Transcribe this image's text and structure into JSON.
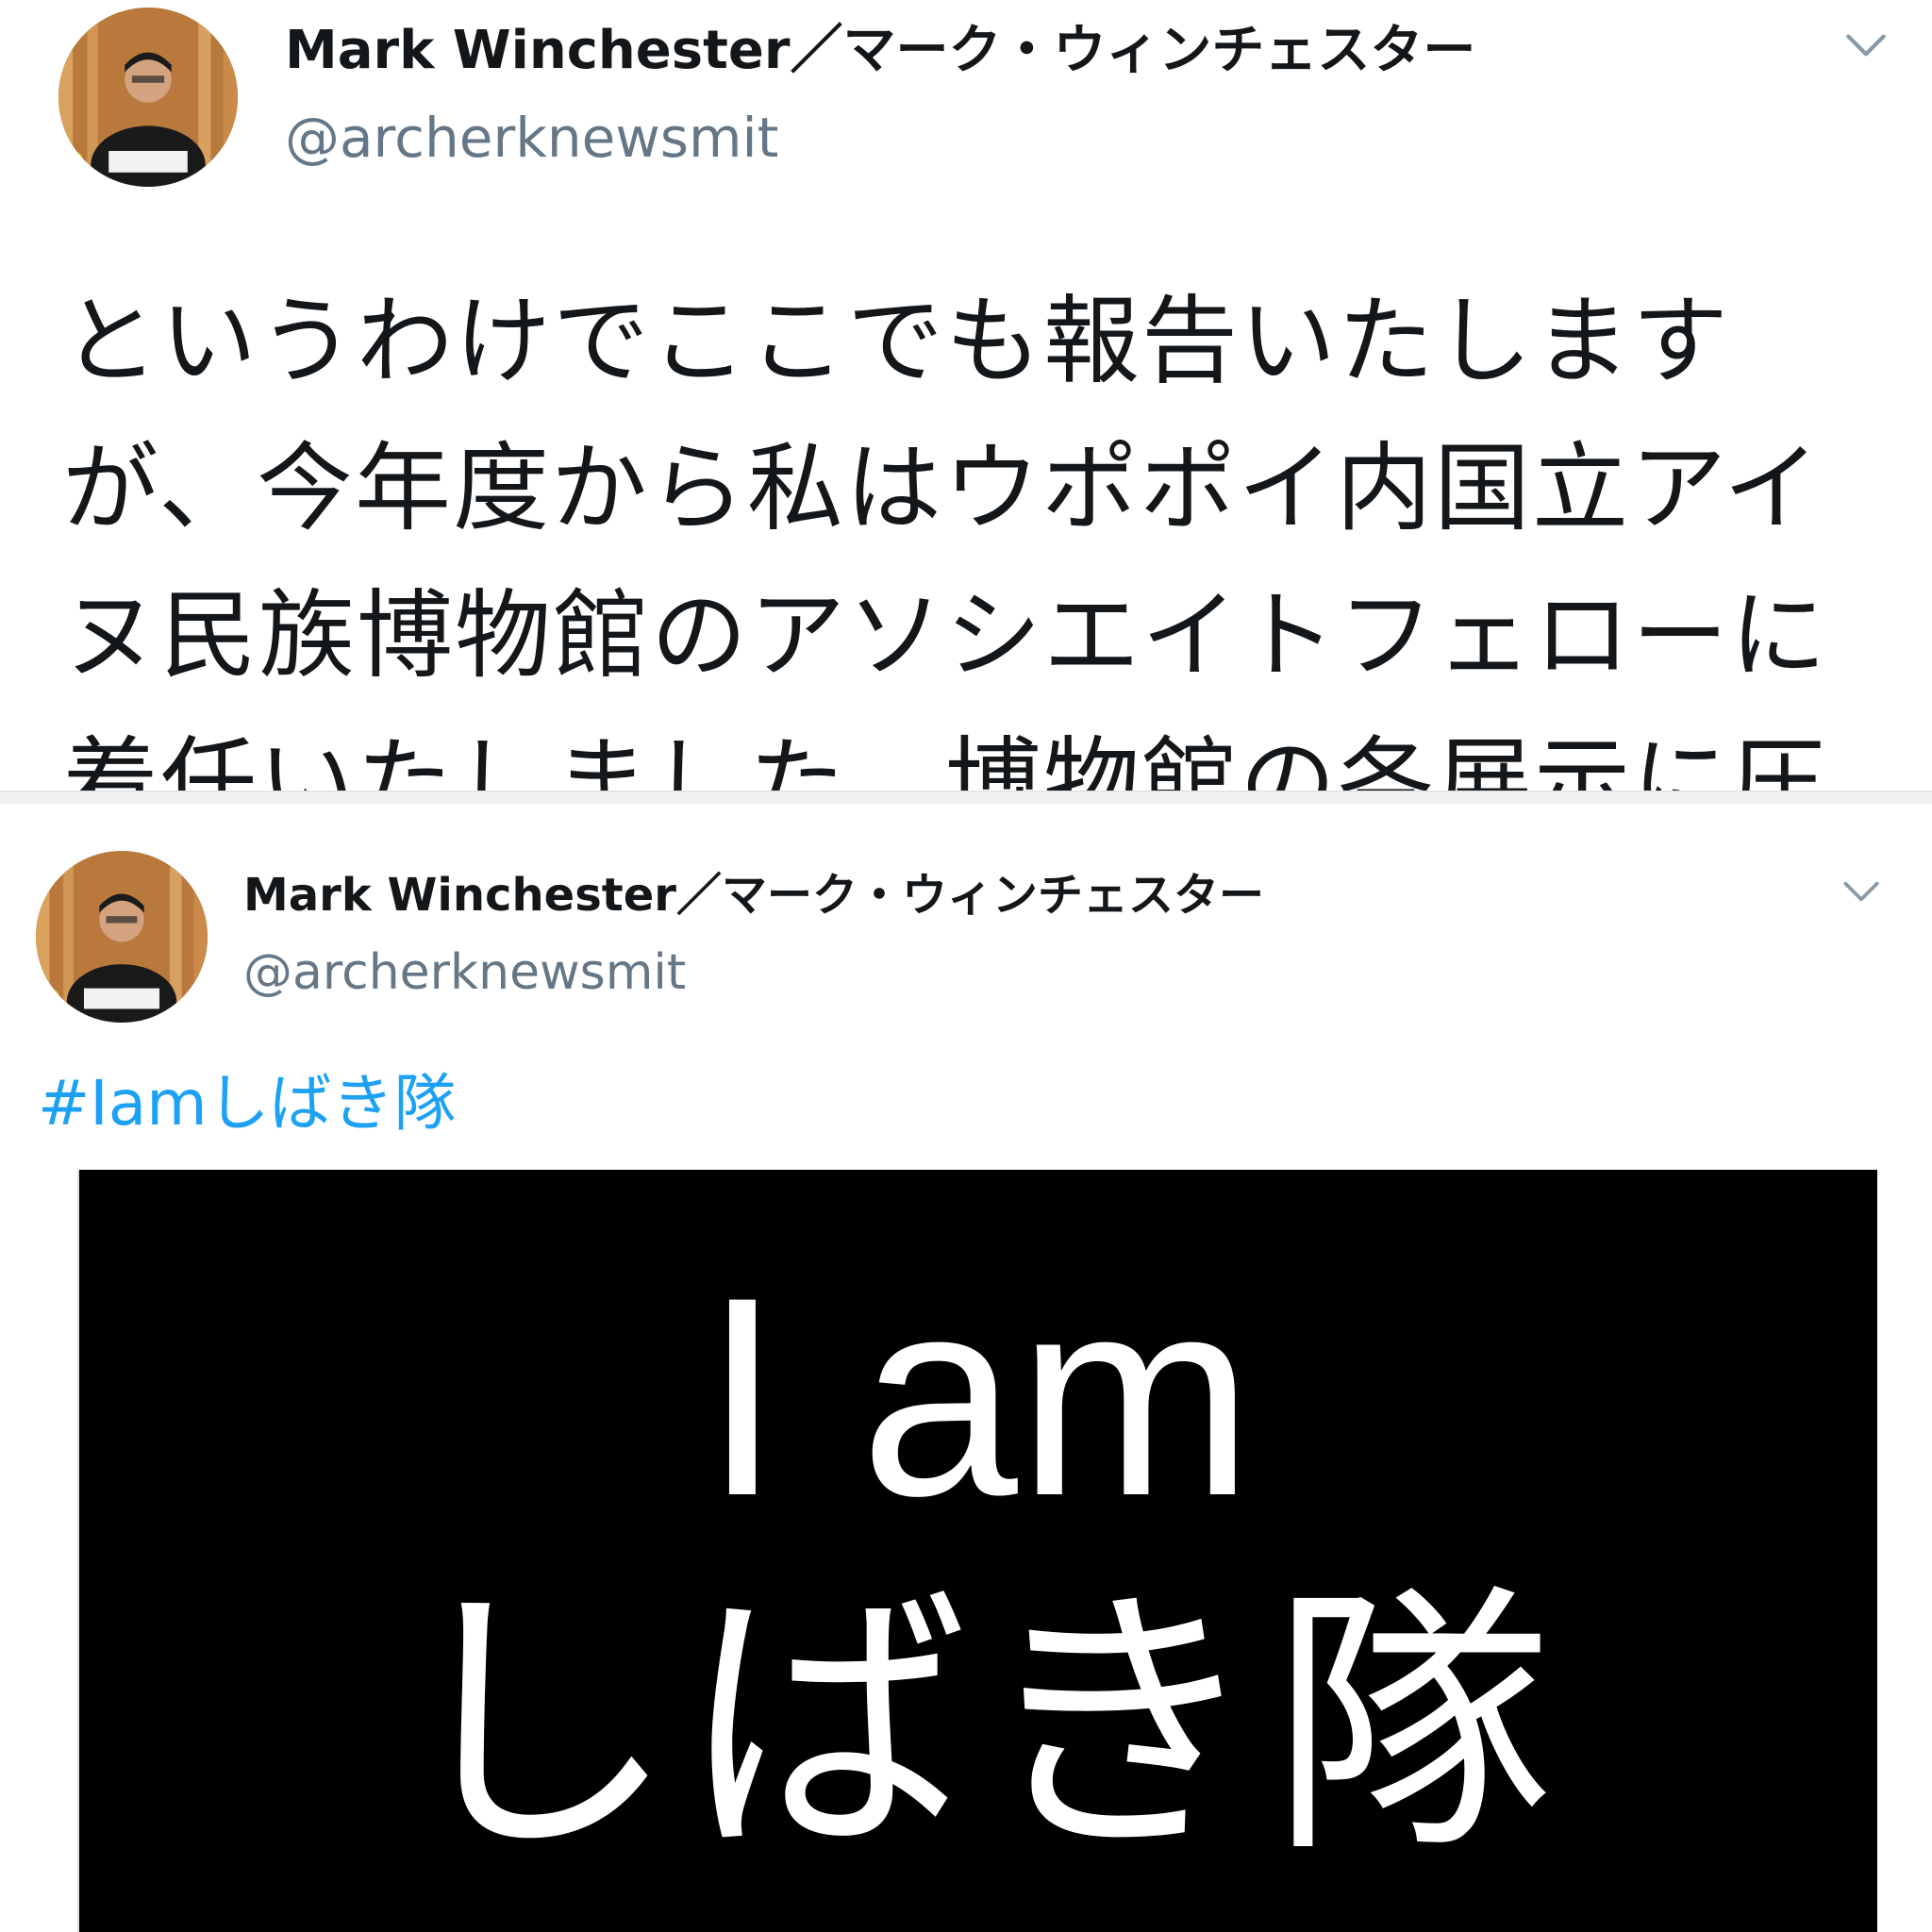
{
  "tweets": [
    {
      "display_name": "Mark Winchester／マーク・ウィンチェスター",
      "handle": "@archerknewsmit",
      "body_lines": [
        "というわけでここでも報告いたします",
        "が、今年度から私はウポポイ内国立アイ",
        "ヌ民族博物館のアソシエイトフェローに",
        "着任いたしました。博物館の各展示に圧"
      ],
      "menu_icon": "chevron-down-icon"
    },
    {
      "display_name": "Mark Winchester／マーク・ウィンチェスター",
      "handle": "@archerknewsmit",
      "hashtag": "#Iamしばき隊",
      "menu_icon": "chevron-down-icon",
      "media": {
        "line1": "I am",
        "line2": "しばき隊"
      }
    }
  ],
  "colors": {
    "link": "#1da1f2",
    "handle": "#657786",
    "text": "#14171a",
    "media_background": "#000000",
    "media_text": "#ffffff"
  }
}
